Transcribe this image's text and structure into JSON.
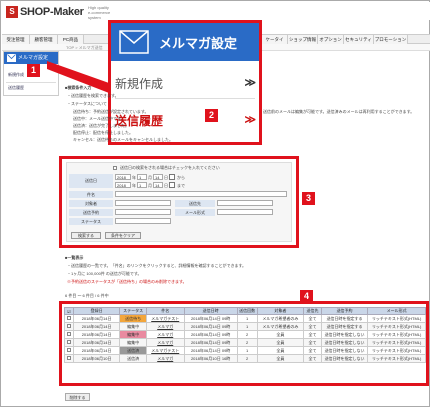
{
  "header": {
    "logo_mark": "S",
    "logo_text": "SHOP-Maker",
    "logo_sub": "High quality e-commerce system"
  },
  "nav": {
    "tabs": [
      {
        "label": "受注管理"
      },
      {
        "label": "顧客管理"
      },
      {
        "label": "PC商品"
      },
      {
        "label": "ケータイ"
      },
      {
        "label": "ショップ情報"
      },
      {
        "label": "オプション"
      },
      {
        "label": "セキュリティ"
      },
      {
        "label": "プロモーション"
      }
    ]
  },
  "breadcrumb": {
    "text": "TOP > メルマガ送信"
  },
  "sidebar": {
    "header_label": "メルマガ設定",
    "items": [
      {
        "label": "新規作成"
      },
      {
        "label": "送信履歴"
      }
    ]
  },
  "callouts": {
    "c1": "1",
    "c2": "2",
    "c3": "3",
    "c4": "4"
  },
  "popup": {
    "title": "メルマガ設定",
    "item_new": "新規作成",
    "item_history": "送信履歴",
    "chevron": "≫"
  },
  "info": {
    "section1": "■検索条件入力",
    "lines": [
      "・送信履歴を検索できます。",
      "・ステータスについて",
      "送信待ち：予約送信が設定されています。",
      "送信中：メール送信中です。",
      "送信済：送信が完了しました。",
      "配信停止：配信を停止しました。",
      "キャンセル：送信待ちのメールをキャンセルしました。"
    ],
    "right_note": "送信前のメールは編集が可能です。送信済みのメールは再利用することができます。"
  },
  "search": {
    "checkbox_label": "送信日の検索をされる場合はチェックを入れてください",
    "send_date_label": "送信日",
    "from_year": "2018",
    "from_month": "1",
    "from_day": "14",
    "from_suffix": "から",
    "to_year": "2018",
    "to_month": "1",
    "to_day": "14",
    "to_suffix": "まで",
    "subject_label": "件名",
    "target_label": "対象者",
    "delivery_label": "送信先",
    "reservation_label": "送信予約",
    "format_label": "メール形式",
    "status_label": "ステータス",
    "search_button": "検索する",
    "clear_button": "条件をクリア"
  },
  "list": {
    "section": "■一覧表示",
    "note1": "・送信履歴の一覧です。「件名」のリンクをクリックすると、詳細情報を確認することができます。",
    "note2": "・1ヶ月に 100,000件 の送信が可能です。",
    "note3": "※予約送信のステータスが「送信待ち」の場合のみ削除できます。",
    "paging": "6 件目 ～ 6 件目 / 6 件中",
    "headers": [
      "☑",
      "登録日",
      "ステータス",
      "件名",
      "送信日時",
      "送信回数",
      "対象者",
      "送信先",
      "送信予約",
      "メール形式"
    ],
    "rows": [
      {
        "date": "2018年06月14日",
        "status": "送信待ち",
        "status_class": "orange",
        "subject": "メルマガテスト",
        "sent": "2018年06月14日 09時",
        "count": "1",
        "target": "メルマガ希望者のみ",
        "dest": "全て",
        "reserve": "送信日時を指定する",
        "format": "リッチテキスト形式(HTML)"
      },
      {
        "date": "2018年06月14日",
        "status": "編集中",
        "status_class": "pink",
        "subject": "メルマガ",
        "sent": "2018年06月14日 09時",
        "count": "1",
        "target": "メルマガ希望者のみ",
        "dest": "全て",
        "reserve": "送信日時を指定する",
        "format": "リッチテキスト形式(HTML)"
      },
      {
        "date": "2018年06月14日",
        "status": "編集中",
        "status_class": "pink",
        "subject": "メルマガ",
        "sent": "2018年06月14日 09時",
        "count": "2",
        "target": "全員",
        "dest": "全て",
        "reserve": "送信日時を指定しない",
        "format": "リッチテキスト形式(HTML)"
      },
      {
        "date": "2018年06月14日",
        "status": "編集中",
        "status_class": "pink",
        "subject": "メルマガ",
        "sent": "2018年06月14日 09時",
        "count": "2",
        "target": "全員",
        "dest": "全て",
        "reserve": "送信日時を指定しない",
        "format": "リッチテキスト形式(HTML)"
      },
      {
        "date": "2018年06月14日",
        "status": "送信済",
        "status_class": "gray",
        "subject": "メルマガテスト",
        "sent": "2018年06月14日 09時",
        "count": "1",
        "target": "全員",
        "dest": "全て",
        "reserve": "送信日時を指定しない",
        "format": "リッチテキスト形式(HTML)"
      },
      {
        "date": "2018年06月10日",
        "status": "送信済",
        "status_class": "gray",
        "subject": "メルマガ",
        "sent": "2018年06月10日 16時",
        "count": "2",
        "target": "全員",
        "dest": "全て",
        "reserve": "送信日時を指定しない",
        "format": "リッチテキスト形式(HTML)"
      }
    ],
    "delete_button": "削除する"
  },
  "colors": {
    "accent_red": "#e0121c",
    "brand_blue": "#2a6bc6"
  }
}
